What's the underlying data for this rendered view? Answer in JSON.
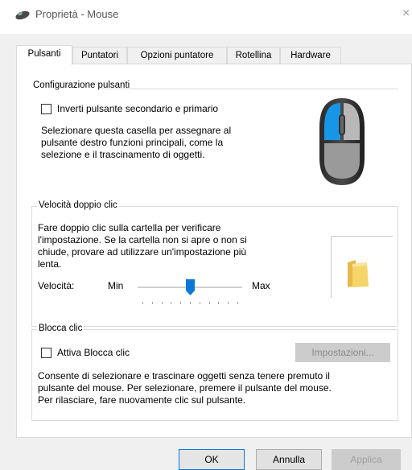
{
  "window": {
    "title": "Proprietà - Mouse",
    "close_glyph": "×"
  },
  "tabs": [
    {
      "label": "Pulsanti",
      "active": true
    },
    {
      "label": "Puntatori",
      "active": false
    },
    {
      "label": "Opzioni puntatore",
      "active": false
    },
    {
      "label": "Rotellina",
      "active": false
    },
    {
      "label": "Hardware",
      "active": false
    }
  ],
  "buttons_config": {
    "legend": "Configurazione pulsanti",
    "swap_checkbox_label": "Inverti pulsante secondario e primario",
    "swap_checked": false,
    "description_lines": [
      "Selezionare questa casella per assegnare al",
      "pulsante destro funzioni principali, come la",
      "selezione e il trascinamento di oggetti."
    ]
  },
  "double_click": {
    "legend": "Velocità doppio clic",
    "description_lines": [
      "Fare doppio clic sulla cartella per verificare",
      "l'impostazione. Se la cartella non si apre o non si",
      "chiude, provare ad utilizzare un'impostazione più",
      "lenta."
    ],
    "speed_label": "Velocità:",
    "min_label": "Min",
    "max_label": "Max",
    "speed_fraction": 0.5
  },
  "click_lock": {
    "legend": "Blocca clic",
    "checkbox_label": "Attiva Blocca clic",
    "checked": false,
    "settings_button": "Impostazioni...",
    "description_lines": [
      "Consente di selezionare e trascinare oggetti senza tenere premuto il",
      "pulsante del mouse. Per selezionare, premere il pulsante del mouse.",
      "Per rilasciare, fare nuovamente clic sul pulsante."
    ]
  },
  "footer": {
    "ok": "OK",
    "cancel": "Annulla",
    "apply": "Applica"
  },
  "colors": {
    "accent": "#0a78d7",
    "mouse_body": "#3a3a3a",
    "folder": "#f5d46a"
  },
  "icons": {
    "title": "mouse-icon",
    "mouse": "mouse-illustration",
    "folder": "folder-icon",
    "thumb": "slider-thumb"
  }
}
